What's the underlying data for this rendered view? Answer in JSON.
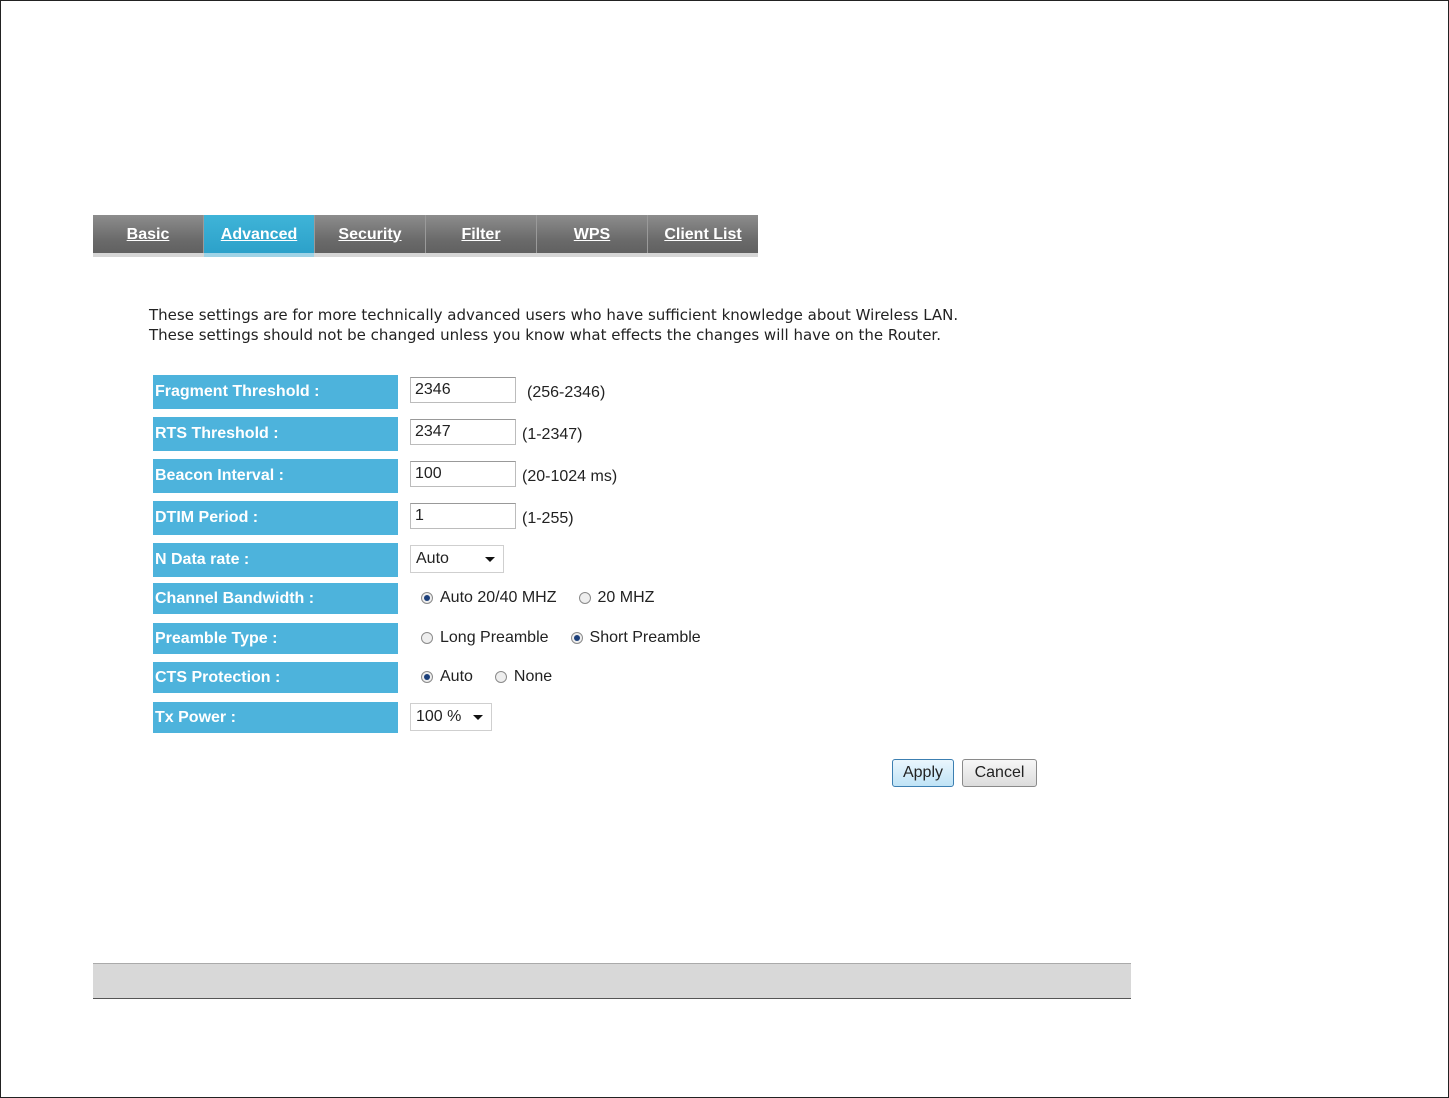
{
  "tabs": [
    {
      "label": "Basic",
      "active": false
    },
    {
      "label": "Advanced",
      "active": true
    },
    {
      "label": "Security",
      "active": false
    },
    {
      "label": "Filter",
      "active": false
    },
    {
      "label": "WPS",
      "active": false
    },
    {
      "label": "Client List",
      "active": false
    }
  ],
  "intro": {
    "line1": "These settings are for more technically advanced users who have sufficient knowledge about Wireless LAN.",
    "line2": "These settings should not be changed unless you know what effects the changes will have on the Router."
  },
  "settings": {
    "fragment_threshold": {
      "label": "Fragment Threshold :",
      "value": "2346",
      "hint": "(256-2346)"
    },
    "rts_threshold": {
      "label": "RTS Threshold :",
      "value": "2347",
      "hint": "(1-2347)"
    },
    "beacon_interval": {
      "label": "Beacon Interval :",
      "value": "100",
      "hint": "(20-1024 ms)"
    },
    "dtim_period": {
      "label": "DTIM Period :",
      "value": "1",
      "hint": "(1-255)"
    },
    "n_data_rate": {
      "label": "N Data rate :",
      "selected": "Auto"
    },
    "channel_bandwidth": {
      "label": "Channel Bandwidth :",
      "opt1": "Auto 20/40 MHZ",
      "opt2": "20 MHZ",
      "selected": "Auto 20/40 MHZ"
    },
    "preamble_type": {
      "label": "Preamble Type :",
      "opt1": "Long Preamble",
      "opt2": "Short Preamble",
      "selected": "Short Preamble"
    },
    "cts_protection": {
      "label": "CTS Protection :",
      "opt1": "Auto",
      "opt2": "None",
      "selected": "Auto"
    },
    "tx_power": {
      "label": "Tx Power :",
      "selected": "100 %"
    }
  },
  "buttons": {
    "apply": "Apply",
    "cancel": "Cancel"
  },
  "colors": {
    "label_bg": "#4db3dc",
    "active_tab": "#2a9fc8",
    "tab_bg": "#6a6a6a"
  }
}
